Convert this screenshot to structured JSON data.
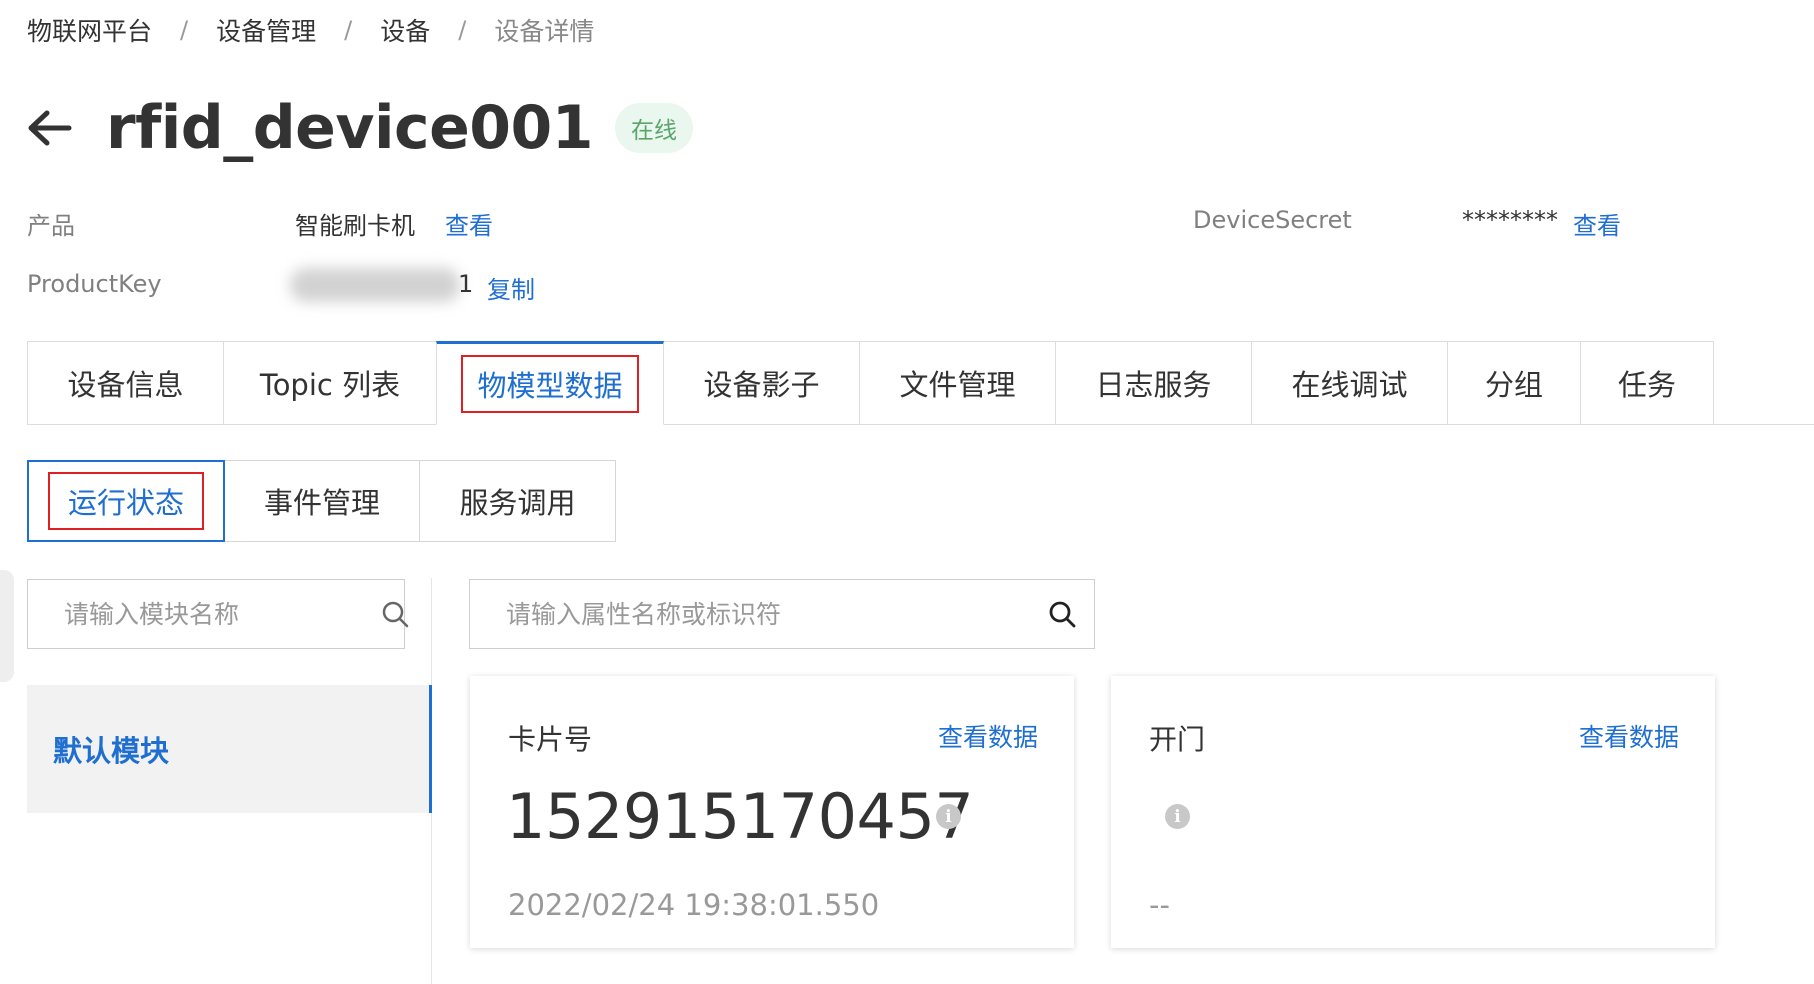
{
  "breadcrumb": {
    "items": [
      "物联网平台",
      "设备管理",
      "设备",
      "设备详情"
    ],
    "separator": "/"
  },
  "header": {
    "back_icon": "arrow-left-icon",
    "title": "rfid_device001",
    "status": "在线"
  },
  "info": {
    "product_label": "产品",
    "product_value": "智能刷卡机",
    "product_link": "查看",
    "productkey_label": "ProductKey",
    "productkey_visible_suffix": "1",
    "productkey_link": "复制",
    "devicesecret_label": "DeviceSecret",
    "devicesecret_value": "********",
    "devicesecret_link": "查看"
  },
  "tabs": [
    {
      "label": "设备信息"
    },
    {
      "label": "Topic 列表"
    },
    {
      "label": "物模型数据"
    },
    {
      "label": "设备影子"
    },
    {
      "label": "文件管理"
    },
    {
      "label": "日志服务"
    },
    {
      "label": "在线调试"
    },
    {
      "label": "分组"
    },
    {
      "label": "任务"
    }
  ],
  "active_tab": "物模型数据",
  "subtabs": [
    {
      "label": "运行状态"
    },
    {
      "label": "事件管理"
    },
    {
      "label": "服务调用"
    }
  ],
  "active_subtab": "运行状态",
  "module_search": {
    "placeholder": "请输入模块名称",
    "icon": "search-icon"
  },
  "property_search": {
    "placeholder": "请输入属性名称或标识符",
    "icon": "search-icon"
  },
  "modules": [
    {
      "label": "默认模块",
      "active": true
    }
  ],
  "cards": [
    {
      "title": "卡片号",
      "link": "查看数据",
      "value": "152915170457",
      "time": "2022/02/24 19:38:01.550",
      "info_icon": "i"
    },
    {
      "title": "开门",
      "link": "查看数据",
      "value": "",
      "time": "--",
      "info_icon": "i"
    }
  ],
  "colors": {
    "accent": "#1f6fd1",
    "highlight_box": "#e02020",
    "online_badge_bg": "#eaf7ee",
    "online_badge_text": "#5aa56a"
  }
}
